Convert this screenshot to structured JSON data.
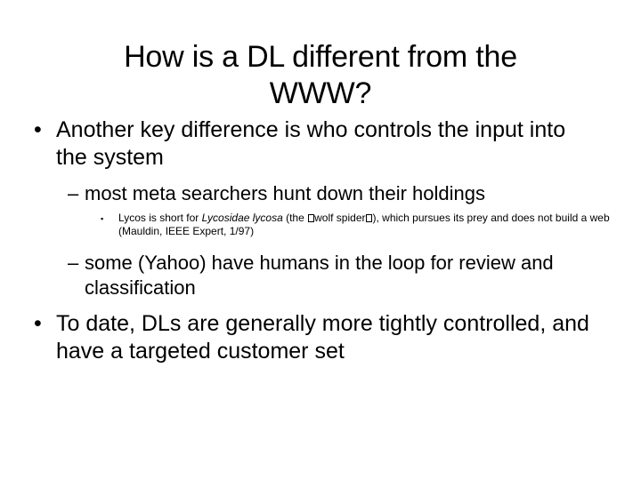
{
  "slide": {
    "background_color": "#ffffff",
    "text_color": "#000000",
    "title": {
      "line1": "How is a DL different from the",
      "line2": "WWW?"
    },
    "markers": {
      "level1": "•",
      "level2": "–",
      "level3": "▪"
    },
    "bullets": {
      "b1": {
        "level": 1,
        "text": "Another key difference is who controls the input into the system"
      },
      "b2": {
        "level": 2,
        "text": "most meta searchers hunt down their holdings"
      },
      "b3": {
        "level": 3,
        "part1": "Lycos is short for ",
        "italic": "Lycosidae lycosa",
        "part2": " (the ",
        "tofu1": "□",
        "part3": "wolf spider",
        "tofu2": "□",
        "part4": "), which pursues its prey and does not build a web (Mauldin, IEEE Expert, 1/97)"
      },
      "b4": {
        "level": 2,
        "text": "some (Yahoo) have humans in the loop for review and classification"
      },
      "b5": {
        "level": 1,
        "text": "To date, DLs are generally more tightly controlled, and have a targeted customer set"
      }
    }
  }
}
